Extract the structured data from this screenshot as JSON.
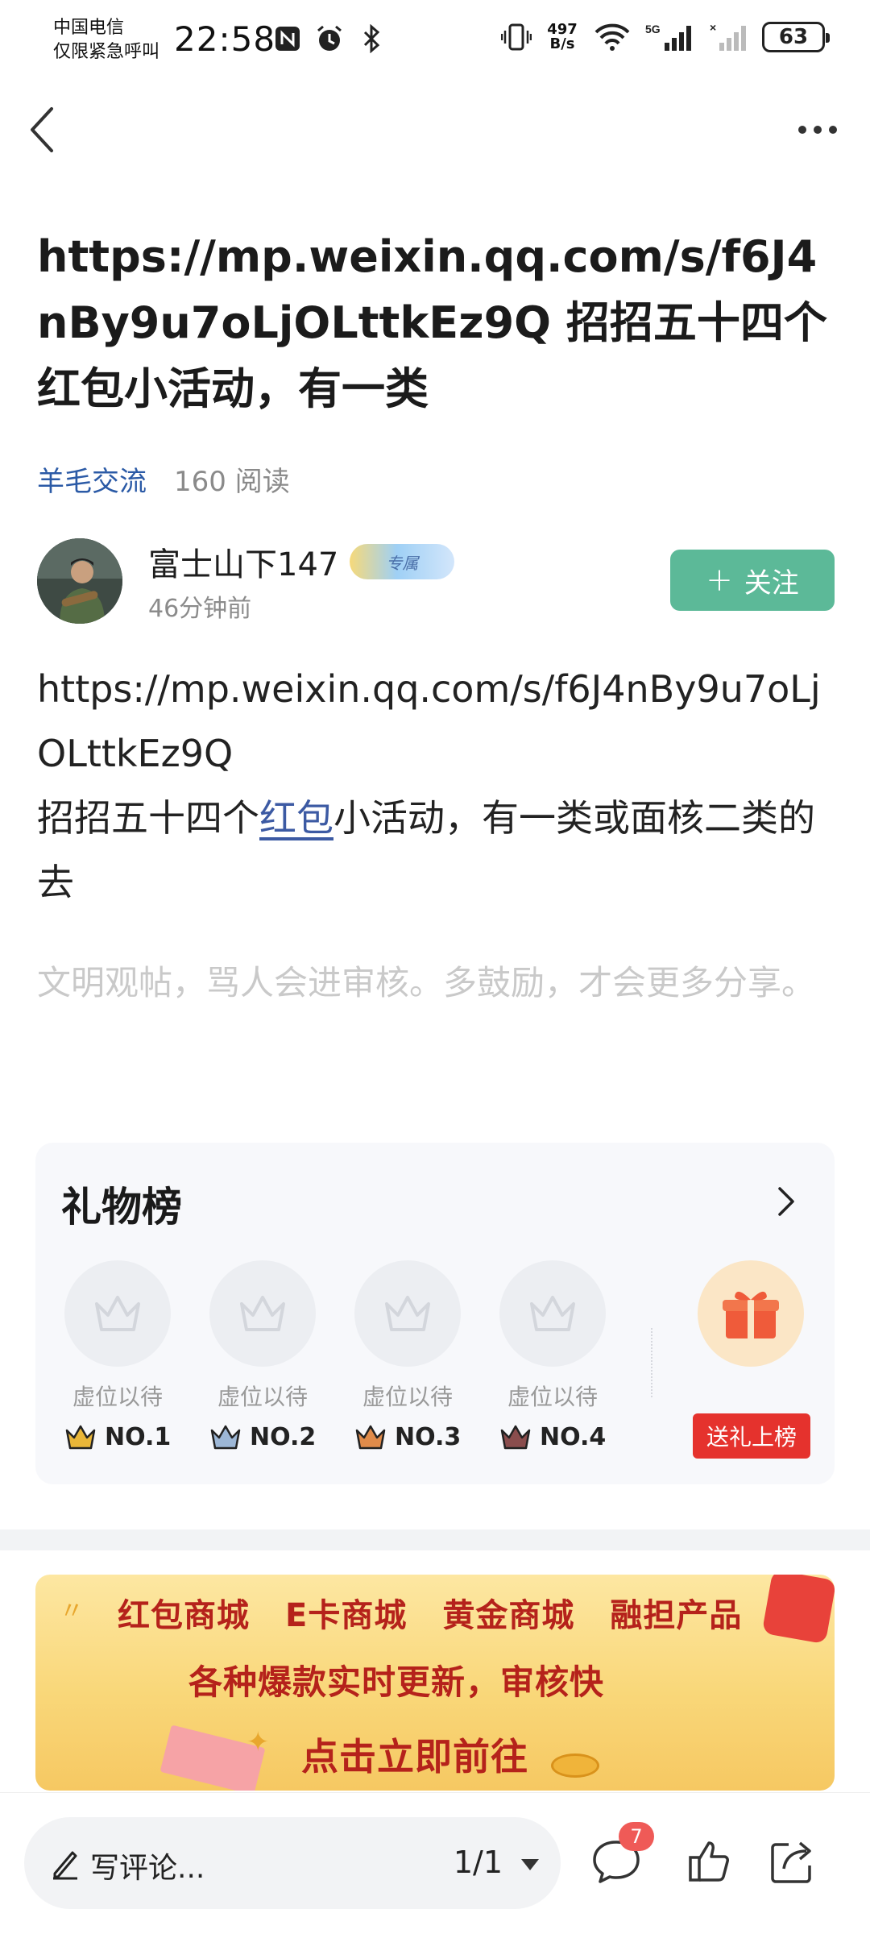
{
  "status_bar": {
    "carrier_line1": "中国电信",
    "carrier_line2": "仅限紧急呼叫",
    "time": "22:58",
    "net_speed_value": "497",
    "net_speed_unit": "B/s",
    "battery": "63",
    "icons": [
      "nfc-icon",
      "alarm-icon",
      "bluetooth-icon",
      "vibrate-icon",
      "wifi-icon",
      "signal-5g-icon",
      "signal-no-sim-icon",
      "battery-icon"
    ]
  },
  "nav": {
    "back_icon": "back-icon",
    "more_icon": "more-icon"
  },
  "post": {
    "title": "https://mp.weixin.qq.com/s/f6J4nBy9u7oLjOLttkEz9Q 招招五十四个红包小活动，有一类",
    "section": "羊毛交流",
    "reads": "160 阅读",
    "author": {
      "name": "富士山下147",
      "badge_text": "专属",
      "time": "46分钟前",
      "follow_label": "关注"
    },
    "body_line1": "https://mp.weixin.qq.com/s/f6J4nBy9u7oLjOLttkEz9Q",
    "body_line2_pre": "招招五十四个",
    "body_link": "红包",
    "body_line2_post": "小活动，有一类或面核二类的去",
    "notice": "文明观帖，骂人会进审核。多鼓励，才会更多分享。"
  },
  "gift_board": {
    "title": "礼物榜",
    "slots": [
      {
        "placeholder": "虚位以待",
        "rank": "NO.1",
        "crown_color": "#e9b638"
      },
      {
        "placeholder": "虚位以待",
        "rank": "NO.2",
        "crown_color": "#9db7d6"
      },
      {
        "placeholder": "虚位以待",
        "rank": "NO.3",
        "crown_color": "#e08b4a"
      },
      {
        "placeholder": "虚位以待",
        "rank": "NO.4",
        "crown_color": "#8a4d4d"
      }
    ],
    "send_label": "送礼上榜"
  },
  "banner": {
    "items": [
      "红包商城",
      "E卡商城",
      "黄金商城",
      "融担产品"
    ],
    "line2": "各种爆款实时更新，审核快",
    "line3": "点击立即前往"
  },
  "bottom_bar": {
    "comment_placeholder": "写评论...",
    "page_indicator": "1/1",
    "comment_count": "7"
  },
  "colors": {
    "follow_button": "#5cb998",
    "section_link": "#2b5aa6",
    "send_gift": "#e5322d",
    "badge_red": "#ef5a57"
  }
}
